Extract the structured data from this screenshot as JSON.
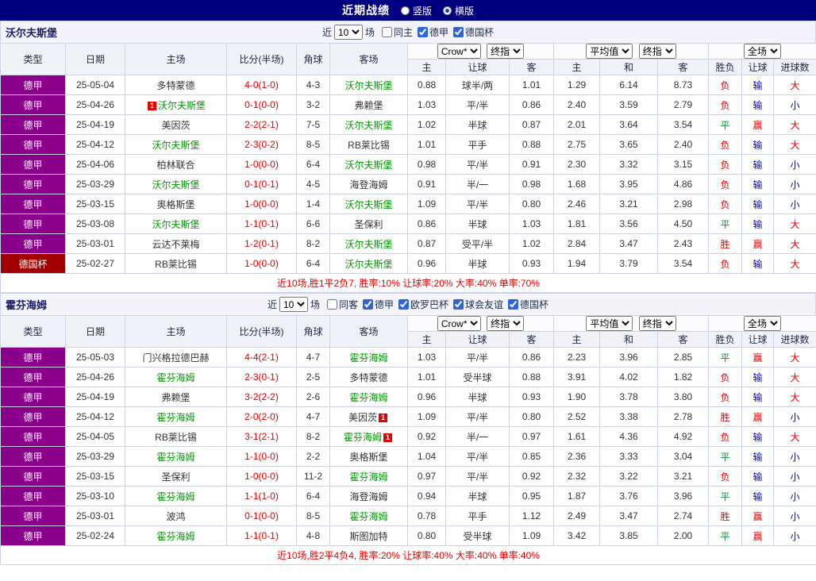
{
  "topbar": {
    "title": "近期战绩",
    "vertical": "竖版",
    "horizontal": "横版"
  },
  "filter_labels": {
    "near": "近",
    "matches": "场"
  },
  "dropdowns": {
    "near_count": "10",
    "bookmaker": "Crow*",
    "final": "终指",
    "average": "平均值",
    "final2": "终指",
    "fulltime": "全场"
  },
  "columns": {
    "type": "类型",
    "date": "日期",
    "home": "主场",
    "score": "比分(半场)",
    "corner": "角球",
    "away": "客场",
    "ah_home": "主",
    "ah_line": "让球",
    "ah_away": "客",
    "eu_home": "主",
    "eu_draw": "和",
    "eu_away": "客",
    "result": "胜负",
    "handicap": "让球",
    "goals": "进球数"
  },
  "colors": {
    "topbar_bg": "#000080",
    "league_bg": "#8B008B",
    "cup_bg": "#A00000",
    "team_highlight": "#009900",
    "red": "#E60000",
    "blue": "#0000CC",
    "green": "#009933"
  },
  "sections": [
    {
      "team": "沃尔夫斯堡",
      "filter_options": [
        {
          "label": "同主",
          "checked": false
        },
        {
          "label": "德甲",
          "checked": true
        },
        {
          "label": "德国杯",
          "checked": true
        }
      ],
      "rows": [
        {
          "league": "德甲",
          "date": "25-05-04",
          "home": "多特蒙德",
          "home_hl": false,
          "score": "4-0(1-0)",
          "corner": "4-3",
          "away": "沃尔夫斯堡",
          "away_hl": true,
          "ah": [
            "0.88",
            "球半/两",
            "1.01"
          ],
          "eu": [
            "1.29",
            "6.14",
            "8.73"
          ],
          "res": [
            "负",
            "输",
            "大"
          ]
        },
        {
          "league": "德甲",
          "date": "25-04-26",
          "home": "沃尔夫斯堡",
          "home_hl": true,
          "home_rc": "1",
          "score": "0-1(0-0)",
          "corner": "3-2",
          "away": "弗赖堡",
          "away_hl": false,
          "ah": [
            "1.03",
            "平/半",
            "0.86"
          ],
          "eu": [
            "2.40",
            "3.59",
            "2.79"
          ],
          "res": [
            "负",
            "输",
            "小"
          ]
        },
        {
          "league": "德甲",
          "date": "25-04-19",
          "home": "美因茨",
          "home_hl": false,
          "score": "2-2(2-1)",
          "corner": "7-5",
          "away": "沃尔夫斯堡",
          "away_hl": true,
          "ah": [
            "1.02",
            "半球",
            "0.87"
          ],
          "eu": [
            "2.01",
            "3.64",
            "3.54"
          ],
          "res": [
            "平",
            "赢",
            "大"
          ]
        },
        {
          "league": "德甲",
          "date": "25-04-12",
          "home": "沃尔夫斯堡",
          "home_hl": true,
          "score": "2-3(0-2)",
          "corner": "8-5",
          "away": "RB莱比锡",
          "away_hl": false,
          "ah": [
            "1.01",
            "平手",
            "0.88"
          ],
          "eu": [
            "2.75",
            "3.65",
            "2.40"
          ],
          "res": [
            "负",
            "输",
            "大"
          ]
        },
        {
          "league": "德甲",
          "date": "25-04-06",
          "home": "柏林联合",
          "home_hl": false,
          "score": "1-0(0-0)",
          "corner": "6-4",
          "away": "沃尔夫斯堡",
          "away_hl": true,
          "ah": [
            "0.98",
            "平/半",
            "0.91"
          ],
          "eu": [
            "2.30",
            "3.32",
            "3.15"
          ],
          "res": [
            "负",
            "输",
            "小"
          ]
        },
        {
          "league": "德甲",
          "date": "25-03-29",
          "home": "沃尔夫斯堡",
          "home_hl": true,
          "score": "0-1(0-1)",
          "corner": "4-5",
          "away": "海登海姆",
          "away_hl": false,
          "ah": [
            "0.91",
            "半/一",
            "0.98"
          ],
          "eu": [
            "1.68",
            "3.95",
            "4.86"
          ],
          "res": [
            "负",
            "输",
            "小"
          ]
        },
        {
          "league": "德甲",
          "date": "25-03-15",
          "home": "奥格斯堡",
          "home_hl": false,
          "score": "1-0(0-0)",
          "corner": "1-4",
          "away": "沃尔夫斯堡",
          "away_hl": true,
          "ah": [
            "1.09",
            "平/半",
            "0.80"
          ],
          "eu": [
            "2.46",
            "3.21",
            "2.98"
          ],
          "res": [
            "负",
            "输",
            "小"
          ]
        },
        {
          "league": "德甲",
          "date": "25-03-08",
          "home": "沃尔夫斯堡",
          "home_hl": true,
          "score": "1-1(0-1)",
          "corner": "6-6",
          "away": "圣保利",
          "away_hl": false,
          "ah": [
            "0.86",
            "半球",
            "1.03"
          ],
          "eu": [
            "1.81",
            "3.56",
            "4.50"
          ],
          "res": [
            "平",
            "输",
            "大"
          ]
        },
        {
          "league": "德甲",
          "date": "25-03-01",
          "home": "云达不莱梅",
          "home_hl": false,
          "score": "1-2(0-1)",
          "corner": "8-2",
          "away": "沃尔夫斯堡",
          "away_hl": true,
          "ah": [
            "0.87",
            "受平/半",
            "1.02"
          ],
          "eu": [
            "2.84",
            "3.47",
            "2.43"
          ],
          "res": [
            "胜",
            "赢",
            "大"
          ]
        },
        {
          "league": "德国杯",
          "date": "25-02-27",
          "home": "RB莱比锡",
          "home_hl": false,
          "score": "1-0(0-0)",
          "corner": "6-4",
          "away": "沃尔夫斯堡",
          "away_hl": true,
          "ah": [
            "0.96",
            "半球",
            "0.93"
          ],
          "eu": [
            "1.94",
            "3.79",
            "3.54"
          ],
          "res": [
            "负",
            "输",
            "大"
          ]
        }
      ],
      "summary": "近10场,胜1平2负7, 胜率:10% 让球率:20% 大率:40% 单率:70%"
    },
    {
      "team": "霍芬海姆",
      "filter_options": [
        {
          "label": "同客",
          "checked": false
        },
        {
          "label": "德甲",
          "checked": true
        },
        {
          "label": "欧罗巴杯",
          "checked": true
        },
        {
          "label": "球会友谊",
          "checked": true
        },
        {
          "label": "德国杯",
          "checked": true
        }
      ],
      "rows": [
        {
          "league": "德甲",
          "date": "25-05-03",
          "home": "门兴格拉德巴赫",
          "home_hl": false,
          "score": "4-4(2-1)",
          "corner": "4-7",
          "away": "霍芬海姆",
          "away_hl": true,
          "ah": [
            "1.03",
            "平/半",
            "0.86"
          ],
          "eu": [
            "2.23",
            "3.96",
            "2.85"
          ],
          "res": [
            "平",
            "赢",
            "大"
          ]
        },
        {
          "league": "德甲",
          "date": "25-04-26",
          "home": "霍芬海姆",
          "home_hl": true,
          "score": "2-3(0-1)",
          "corner": "2-5",
          "away": "多特蒙德",
          "away_hl": false,
          "ah": [
            "1.01",
            "受半球",
            "0.88"
          ],
          "eu": [
            "3.91",
            "4.02",
            "1.82"
          ],
          "res": [
            "负",
            "输",
            "大"
          ]
        },
        {
          "league": "德甲",
          "date": "25-04-19",
          "home": "弗赖堡",
          "home_hl": false,
          "score": "3-2(2-2)",
          "corner": "2-6",
          "away": "霍芬海姆",
          "away_hl": true,
          "ah": [
            "0.96",
            "半球",
            "0.93"
          ],
          "eu": [
            "1.90",
            "3.78",
            "3.80"
          ],
          "res": [
            "负",
            "输",
            "大"
          ]
        },
        {
          "league": "德甲",
          "date": "25-04-12",
          "home": "霍芬海姆",
          "home_hl": true,
          "score": "2-0(2-0)",
          "corner": "4-7",
          "away": "美因茨",
          "away_hl": false,
          "away_rc": "1",
          "ah": [
            "1.09",
            "平/半",
            "0.80"
          ],
          "eu": [
            "2.52",
            "3.38",
            "2.78"
          ],
          "res": [
            "胜",
            "赢",
            "小"
          ]
        },
        {
          "league": "德甲",
          "date": "25-04-05",
          "home": "RB莱比锡",
          "home_hl": false,
          "score": "3-1(2-1)",
          "corner": "8-2",
          "away": "霍芬海姆",
          "away_hl": true,
          "away_rc": "1",
          "ah": [
            "0.92",
            "半/一",
            "0.97"
          ],
          "eu": [
            "1.61",
            "4.36",
            "4.92"
          ],
          "res": [
            "负",
            "输",
            "大"
          ]
        },
        {
          "league": "德甲",
          "date": "25-03-29",
          "home": "霍芬海姆",
          "home_hl": true,
          "score": "1-1(0-0)",
          "corner": "2-2",
          "away": "奥格斯堡",
          "away_hl": false,
          "ah": [
            "1.04",
            "平/半",
            "0.85"
          ],
          "eu": [
            "2.36",
            "3.33",
            "3.04"
          ],
          "res": [
            "平",
            "输",
            "小"
          ]
        },
        {
          "league": "德甲",
          "date": "25-03-15",
          "home": "圣保利",
          "home_hl": false,
          "score": "1-0(0-0)",
          "corner": "11-2",
          "away": "霍芬海姆",
          "away_hl": true,
          "ah": [
            "0.97",
            "平/半",
            "0.92"
          ],
          "eu": [
            "2.32",
            "3.22",
            "3.21"
          ],
          "res": [
            "负",
            "输",
            "小"
          ]
        },
        {
          "league": "德甲",
          "date": "25-03-10",
          "home": "霍芬海姆",
          "home_hl": true,
          "score": "1-1(1-0)",
          "corner": "6-4",
          "away": "海登海姆",
          "away_hl": false,
          "ah": [
            "0.94",
            "半球",
            "0.95"
          ],
          "eu": [
            "1.87",
            "3.76",
            "3.96"
          ],
          "res": [
            "平",
            "输",
            "小"
          ]
        },
        {
          "league": "德甲",
          "date": "25-03-01",
          "home": "波鸿",
          "home_hl": false,
          "score": "0-1(0-0)",
          "corner": "8-5",
          "away": "霍芬海姆",
          "away_hl": true,
          "ah": [
            "0.78",
            "平手",
            "1.12"
          ],
          "eu": [
            "2.49",
            "3.47",
            "2.74"
          ],
          "res": [
            "胜",
            "赢",
            "小"
          ]
        },
        {
          "league": "德甲",
          "date": "25-02-24",
          "home": "霍芬海姆",
          "home_hl": true,
          "score": "1-1(0-1)",
          "corner": "4-8",
          "away": "斯图加特",
          "away_hl": false,
          "ah": [
            "0.80",
            "受半球",
            "1.09"
          ],
          "eu": [
            "3.42",
            "3.85",
            "2.00"
          ],
          "res": [
            "平",
            "赢",
            "小"
          ]
        }
      ],
      "summary": "近10场,胜2平4负4, 胜率:20% 让球率:40% 大率:40% 单率:40%"
    }
  ]
}
